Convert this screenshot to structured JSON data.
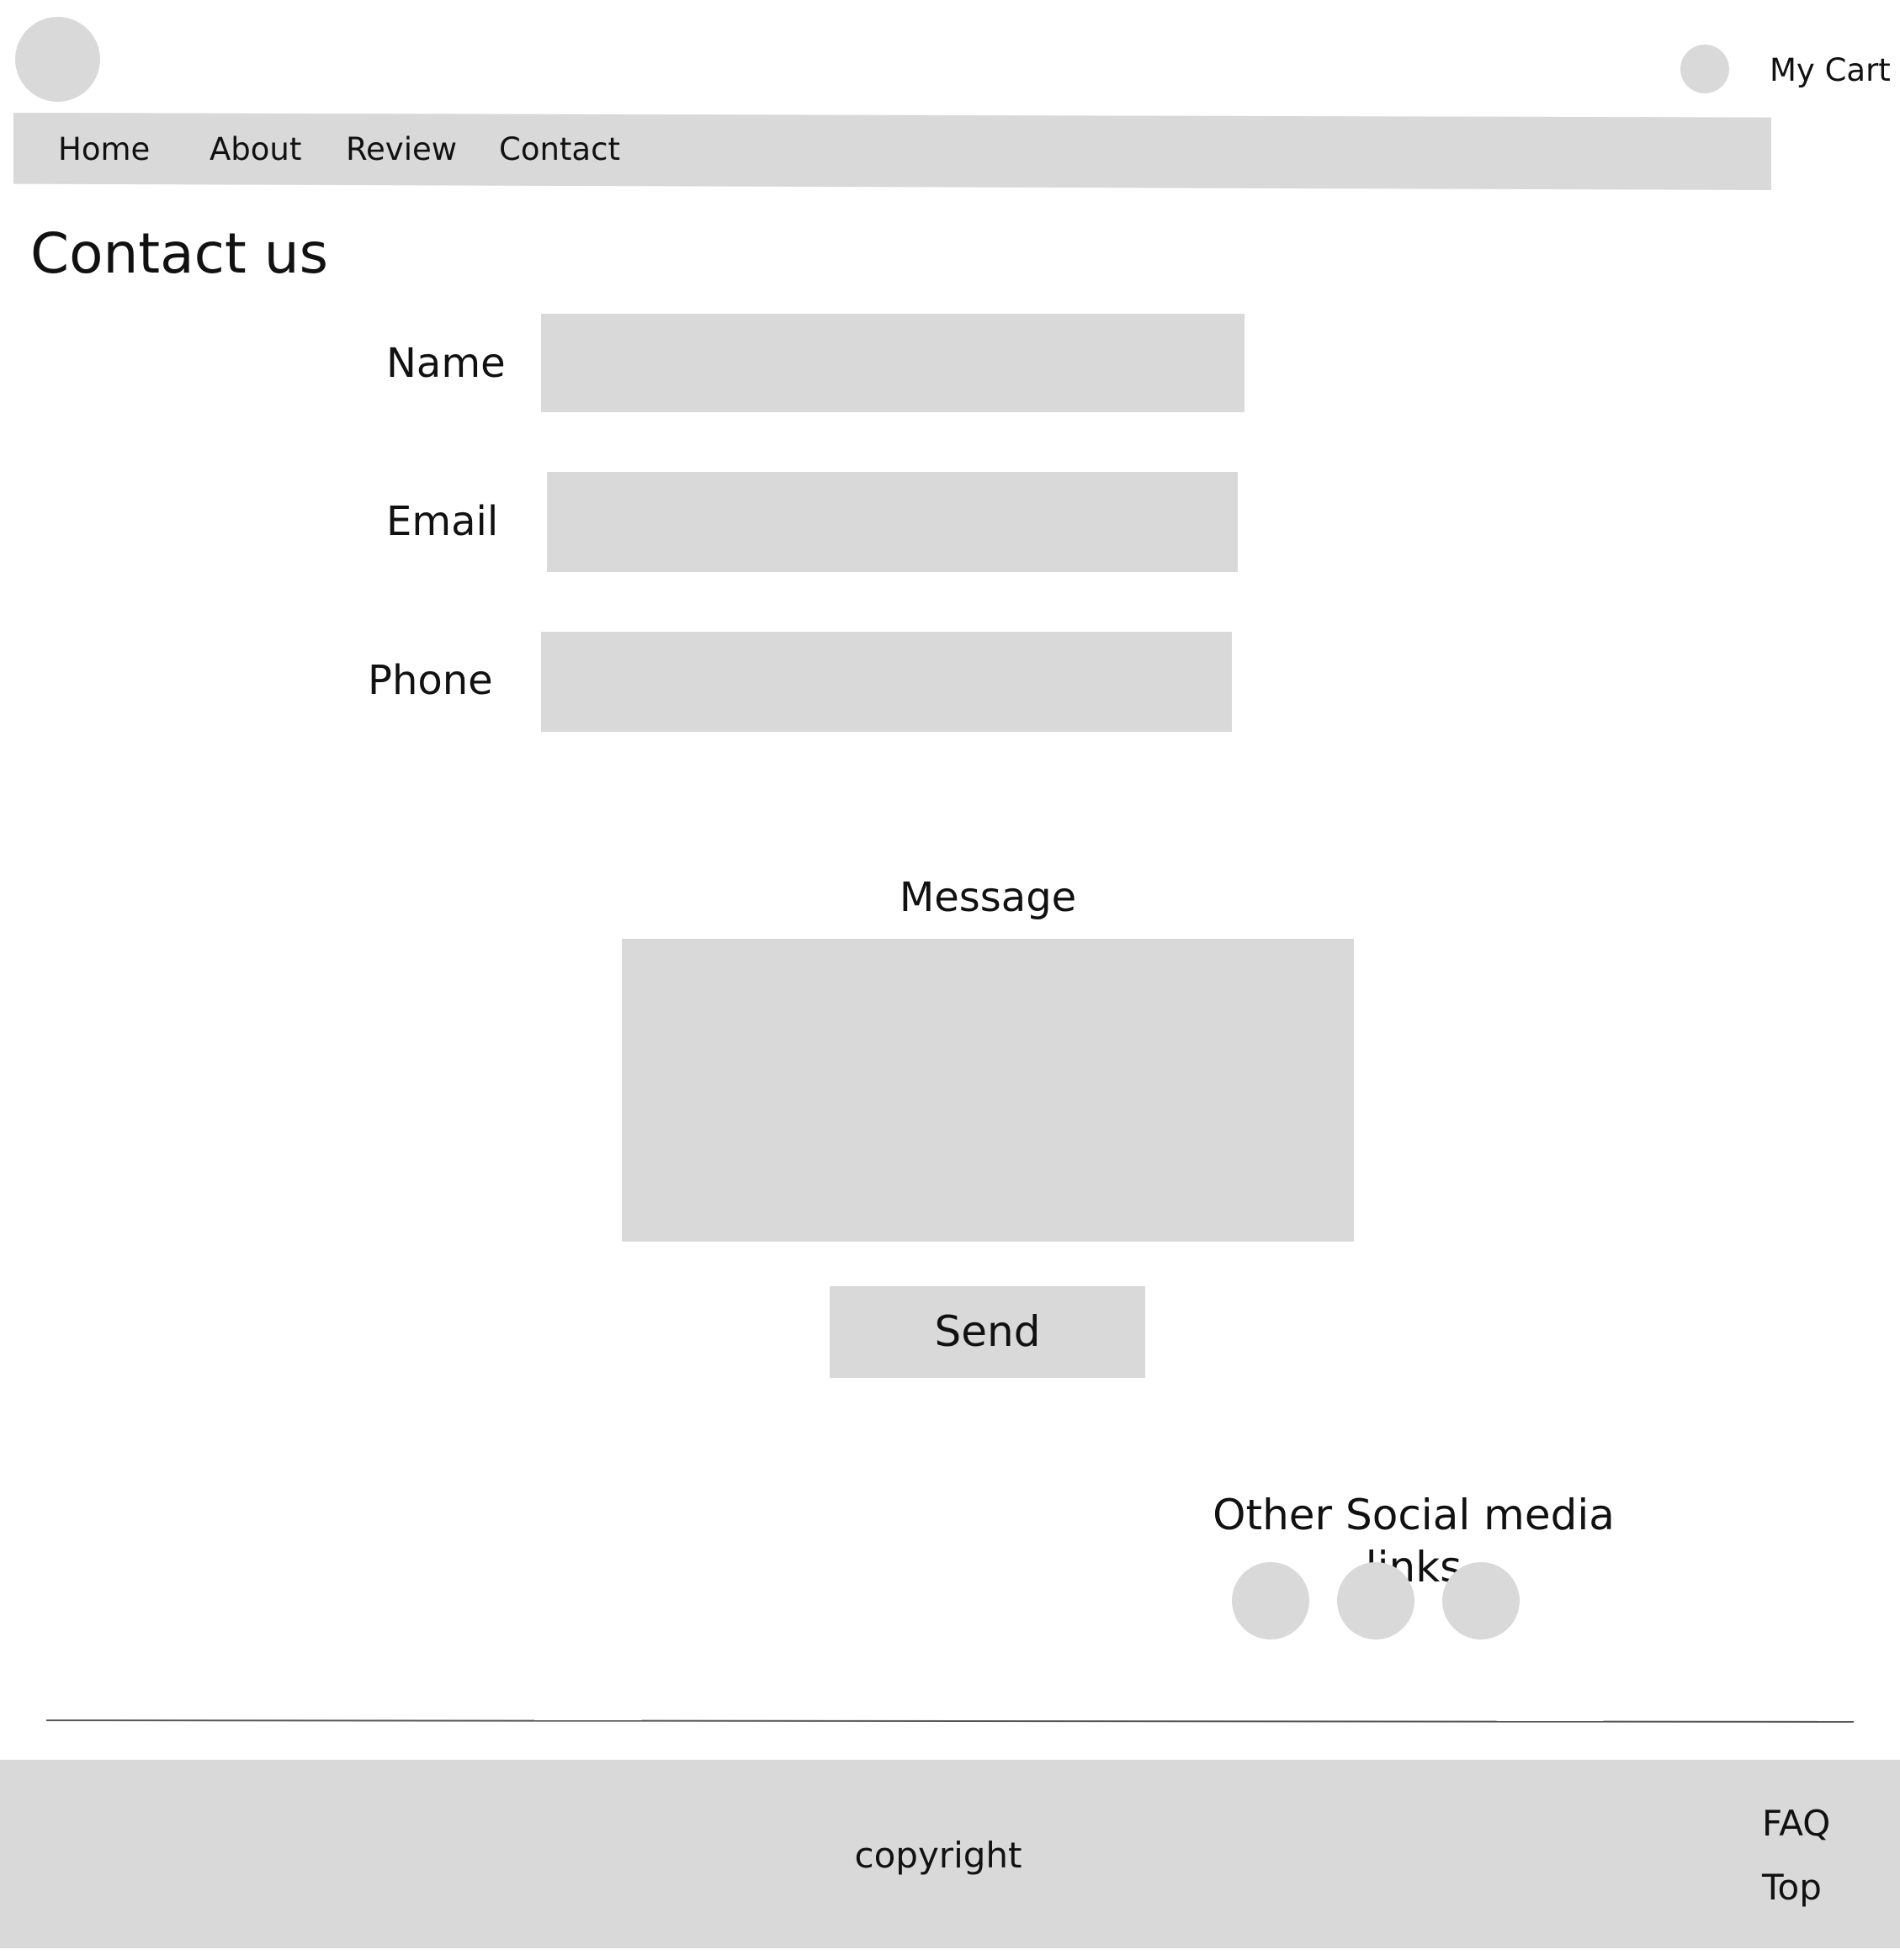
{
  "header": {
    "logo_icon": "logo-placeholder-icon",
    "cart": {
      "icon": "cart-icon",
      "label": "My Cart"
    }
  },
  "nav": {
    "items": [
      {
        "label": "Home"
      },
      {
        "label": "About"
      },
      {
        "label": "Review"
      },
      {
        "label": "Contact"
      }
    ]
  },
  "main": {
    "title": "Contact us",
    "form": {
      "name_label": "Name",
      "name_value": "",
      "email_label": "Email",
      "email_value": "",
      "phone_label": "Phone",
      "phone_value": "",
      "message_label": "Message",
      "message_value": "",
      "send_label": "Send"
    },
    "social": {
      "heading": "Other Social media links",
      "icons": [
        "social-link-icon",
        "social-link-icon",
        "social-link-icon"
      ]
    }
  },
  "footer": {
    "copyright": "copyright",
    "links": [
      {
        "label": "FAQ"
      },
      {
        "label": "Top"
      }
    ]
  },
  "colors": {
    "placeholder_grey": "#d9d9d9",
    "text": "#111111",
    "background": "#ffffff"
  }
}
